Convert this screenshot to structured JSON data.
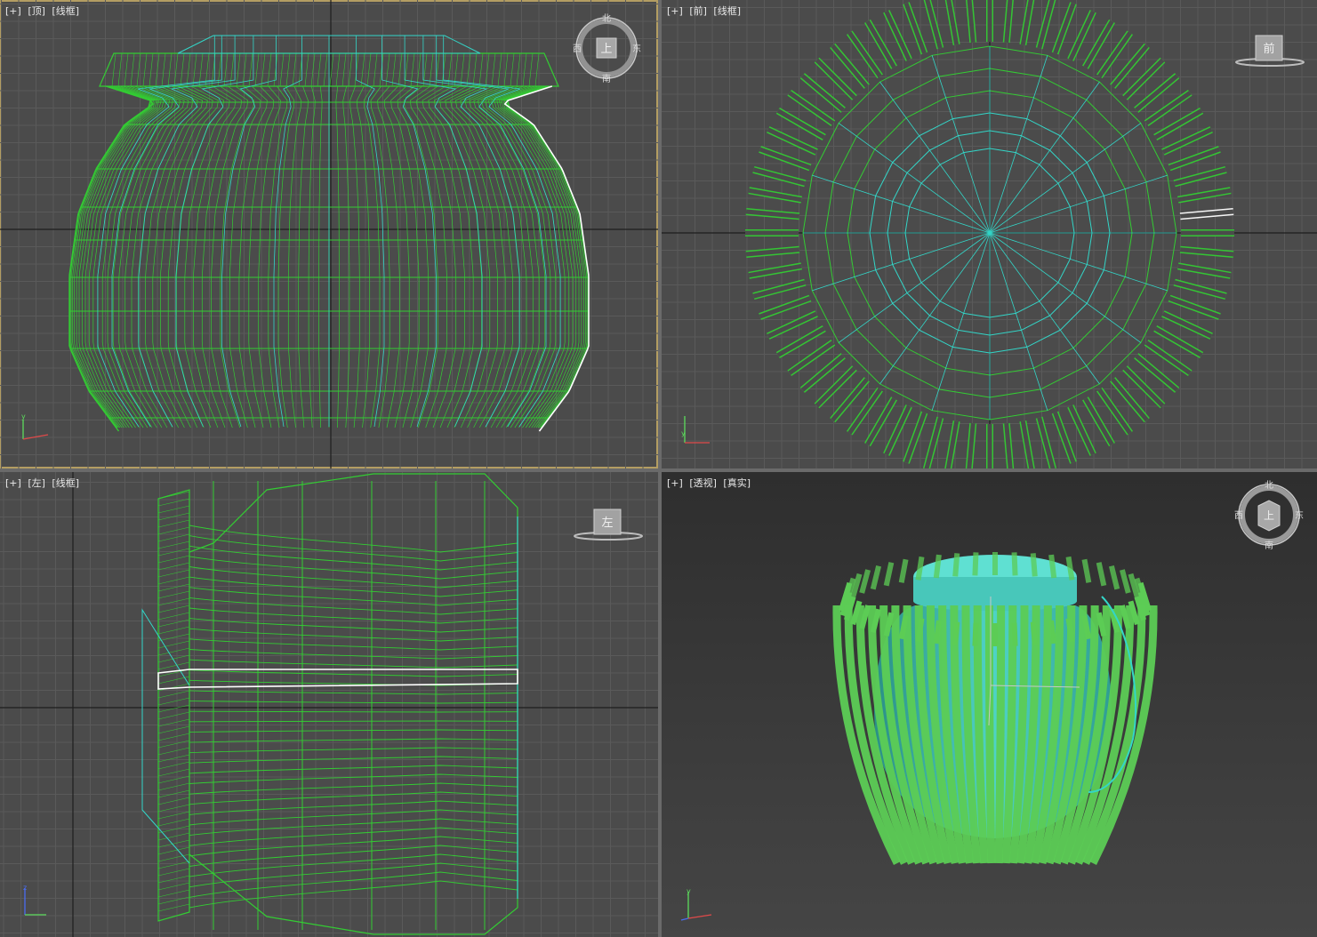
{
  "viewports": {
    "top": {
      "plus": "[+]",
      "view": "[顶]",
      "shading": "[线框]"
    },
    "front": {
      "plus": "[+]",
      "view": "[前]",
      "shading": "[线框]"
    },
    "left": {
      "plus": "[+]",
      "view": "[左]",
      "shading": "[线框]"
    },
    "perspective": {
      "plus": "[+]",
      "view": "[透视]",
      "shading": "[真实]"
    }
  },
  "viewcube": {
    "top": {
      "face": "上",
      "north": "北",
      "south": "南",
      "east": "东",
      "west": "西"
    },
    "front": {
      "face": "前"
    },
    "left": {
      "face": "左"
    },
    "perspective": {
      "face": "上",
      "north": "北",
      "south": "南",
      "east": "东",
      "west": "西"
    }
  },
  "axis_labels": {
    "x": "x",
    "y": "y",
    "z": "z"
  },
  "colors": {
    "viewport_bg": "#4b4b4b",
    "grid": "#5a5a5a",
    "grid_axis": "#1e1e1e",
    "wire_green": "#33cc33",
    "wire_cyan": "#33d6c8",
    "selection_white": "#ffffff",
    "active_border": "#b39d62",
    "vase_fill": "#4fd4c6",
    "stripe_fill": "#5ccc55"
  },
  "icons": [
    "viewcube-icon",
    "axis-tripod-icon"
  ]
}
